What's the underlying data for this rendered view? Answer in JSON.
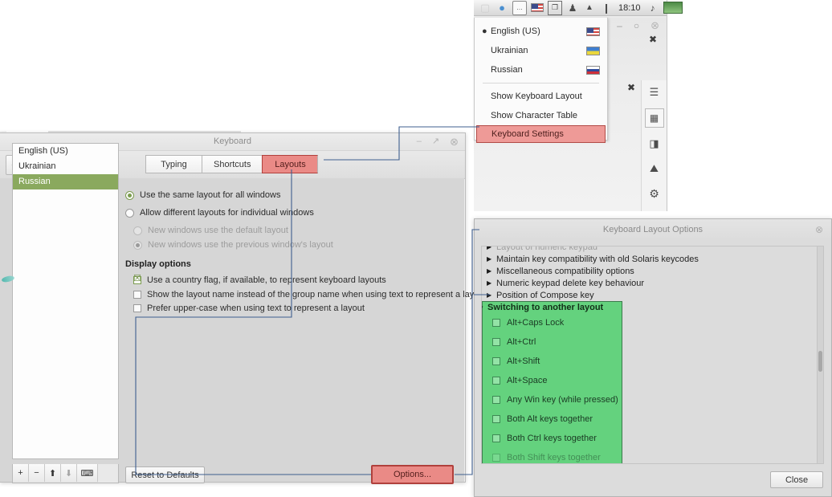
{
  "tray": {
    "clock": "18:10",
    "icons": [
      {
        "name": "app-window-icon",
        "glyph": "▢"
      },
      {
        "name": "browser-icon",
        "glyph": "●"
      },
      {
        "name": "chat-icon",
        "glyph": "…"
      },
      {
        "name": "keyboard-flag-icon",
        "glyph": "flag-us"
      },
      {
        "name": "screenshot-icon",
        "glyph": "❐"
      },
      {
        "name": "user-icon",
        "glyph": "♟"
      },
      {
        "name": "wifi-icon",
        "glyph": "▲"
      },
      {
        "name": "battery-icon",
        "glyph": "❙"
      },
      {
        "name": "music-icon",
        "glyph": "♪"
      },
      {
        "name": "display-icon",
        "glyph": "▬"
      }
    ]
  },
  "layout_menu": {
    "layouts": [
      {
        "label": "English (US)",
        "selected": true,
        "flag": "flag-us"
      },
      {
        "label": "Ukrainian",
        "selected": false,
        "flag": "flag-ua"
      },
      {
        "label": "Russian",
        "selected": false,
        "flag": "flag-ru"
      }
    ],
    "actions": [
      {
        "label": "Show Keyboard Layout"
      },
      {
        "label": "Show Character Table"
      }
    ],
    "highlighted_action": "Keyboard Settings"
  },
  "rail_icons": [
    {
      "name": "close-window-icon",
      "glyph": "✖"
    },
    {
      "name": "menu-lines-icon",
      "glyph": "☰"
    },
    {
      "name": "list-view-icon",
      "glyph": "▦"
    },
    {
      "name": "edit-image-icon",
      "glyph": "◨"
    },
    {
      "name": "picture-icon",
      "glyph": "⛰"
    },
    {
      "name": "settings-gear-icon",
      "glyph": "⚙"
    }
  ],
  "bg_window": {
    "minimize": "–",
    "maximize": "○",
    "close": "⊗",
    "extra_close": "✖"
  },
  "keyboard_window": {
    "title": "Keyboard",
    "back_arrow": "⬅",
    "window_buttons": {
      "minimize": "–",
      "maximize": "↗",
      "close": "⊗"
    },
    "tabs": [
      {
        "label": "Typing",
        "active": false
      },
      {
        "label": "Shortcuts",
        "active": false
      },
      {
        "label": "Layouts",
        "active": true,
        "highlighted": true
      }
    ],
    "layout_list": [
      {
        "label": "English (US)",
        "selected": false
      },
      {
        "label": "Ukrainian",
        "selected": false
      },
      {
        "label": "Russian",
        "selected": true
      }
    ],
    "list_toolbar": [
      {
        "name": "add-layout-button",
        "glyph": "+",
        "enabled": true
      },
      {
        "name": "remove-layout-button",
        "glyph": "−",
        "enabled": true
      },
      {
        "name": "move-up-button",
        "glyph": "⬆",
        "enabled": true
      },
      {
        "name": "move-down-button",
        "glyph": "⬇",
        "enabled": false
      },
      {
        "name": "preview-layout-button",
        "glyph": "⌨",
        "enabled": true
      }
    ],
    "radio_options": [
      {
        "label": "Use the same layout for all windows",
        "checked": true,
        "disabled": false
      },
      {
        "label": "Allow different layouts for individual windows",
        "checked": false,
        "disabled": false
      },
      {
        "label": "New windows use the default layout",
        "checked": false,
        "disabled": true
      },
      {
        "label": "New windows use the previous window's layout",
        "checked": true,
        "disabled": true
      }
    ],
    "display_options_title": "Display options",
    "checkbox_options": [
      {
        "label": "Use a country flag, if available,  to represent keyboard layouts",
        "checked": true
      },
      {
        "label": "Show the layout name instead of the group name when using text to represent a layout",
        "checked": false
      },
      {
        "label": "Prefer upper-case when using text to represent a layout",
        "checked": false
      }
    ],
    "reset_button": "Reset to Defaults",
    "options_button": "Options..."
  },
  "layout_options_dialog": {
    "title": "Keyboard Layout Options",
    "close_x": "⊗",
    "close_button": "Close",
    "tree_rows": [
      {
        "label": "Layout of numeric keypad",
        "expanded": false,
        "clipped": true
      },
      {
        "label": "Maintain key compatibility with old Solaris keycodes",
        "expanded": false
      },
      {
        "label": "Miscellaneous compatibility options",
        "expanded": false
      },
      {
        "label": "Numeric keypad delete key behaviour",
        "expanded": false
      },
      {
        "label": "Position of Compose key",
        "expanded": false
      }
    ],
    "expanded_group": {
      "label": "Switching to another layout",
      "arrow": "▼",
      "items": [
        {
          "label": "Alt+Caps Lock",
          "checked": false
        },
        {
          "label": "Alt+Ctrl",
          "checked": false
        },
        {
          "label": "Alt+Shift",
          "checked": false
        },
        {
          "label": "Alt+Space",
          "checked": false
        },
        {
          "label": "Any Win key (while pressed)",
          "checked": false
        },
        {
          "label": "Both Alt keys together",
          "checked": false
        },
        {
          "label": "Both Ctrl keys together",
          "checked": false
        },
        {
          "label": "Both Shift keys together",
          "checked": false
        }
      ]
    }
  },
  "colors": {
    "highlight_red_fill": "#ea8a86",
    "highlight_red_border": "#b0403c",
    "highlight_green_fill": "#64d27e",
    "selection_green": "#8aa95e",
    "connector_blue": "#3f5f8f"
  }
}
